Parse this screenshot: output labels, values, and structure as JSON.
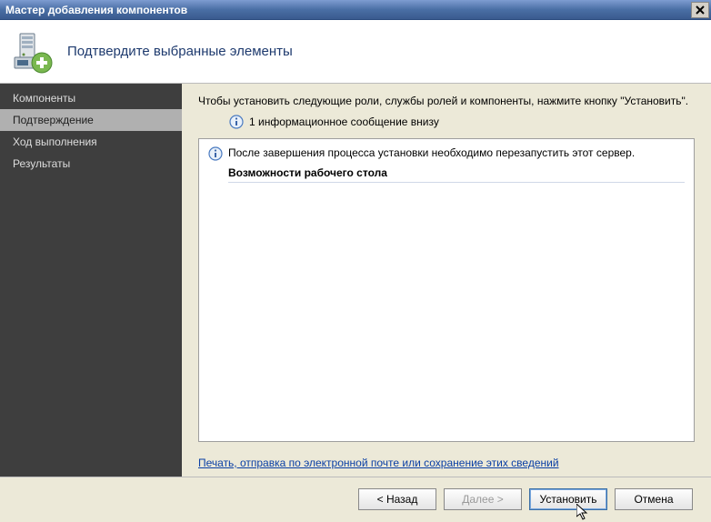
{
  "titlebar": {
    "title": "Мастер добавления компонентов"
  },
  "header": {
    "title": "Подтвердите выбранные элементы"
  },
  "sidebar": {
    "items": [
      {
        "label": "Компоненты",
        "selected": false
      },
      {
        "label": "Подтверждение",
        "selected": true
      },
      {
        "label": "Ход выполнения",
        "selected": false
      },
      {
        "label": "Результаты",
        "selected": false
      }
    ]
  },
  "main": {
    "instruction": "Чтобы установить следующие роли, службы ролей и компоненты, нажмите кнопку \"Установить\".",
    "info_line": "1 информационное сообщение внизу",
    "content_info": "После завершения процесса установки необходимо перезапустить этот сервер.",
    "content_item": "Возможности рабочего стола",
    "link": "Печать, отправка по электронной почте или сохранение этих сведений"
  },
  "footer": {
    "back": "< Назад",
    "next": "Далее >",
    "install": "Установить",
    "cancel": "Отмена"
  }
}
